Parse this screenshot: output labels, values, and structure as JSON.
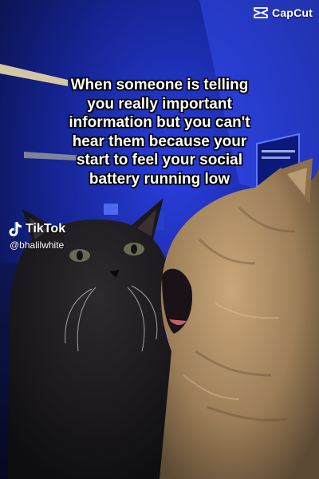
{
  "watermark_capcut": {
    "label": "CapCut"
  },
  "caption": {
    "lines": [
      "When someone is telling",
      "you really important",
      "information but you can't",
      "hear them because your",
      "start to feel your social",
      "battery running low"
    ]
  },
  "watermark_tiktok": {
    "brand": "TikTok",
    "handle": "@bhalilwhite"
  },
  "colors": {
    "background_blue": "#1a2fb5",
    "caption_text": "#ffffff",
    "caption_outline": "#000000",
    "black_cat": "#1c1a1d",
    "tabby_cat": "#a98a63"
  }
}
